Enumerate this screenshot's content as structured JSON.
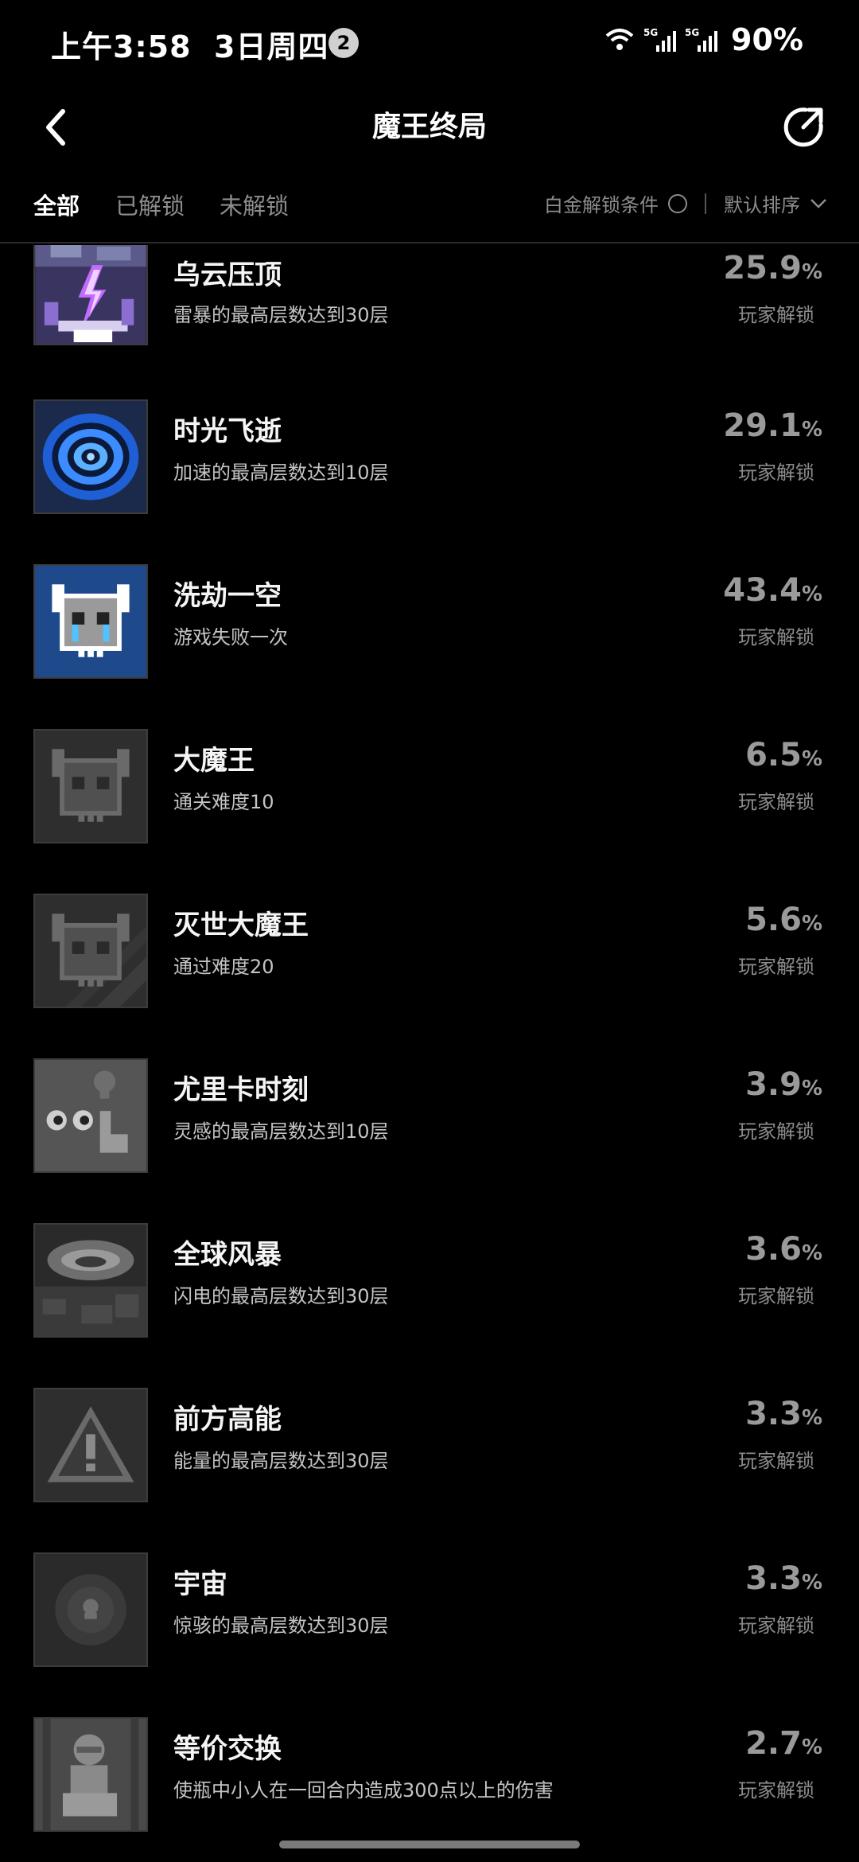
{
  "status": {
    "time": "上午3:58",
    "date": "3日周四",
    "notification_count": "2",
    "network": "5G",
    "battery": "90%",
    "icons": [
      "wifi-icon",
      "signal-5g-icon",
      "signal-5g-icon"
    ]
  },
  "header": {
    "title": "魔王终局",
    "back_icon": "chevron-left-icon",
    "share_icon": "share-icon"
  },
  "filter": {
    "tabs": [
      {
        "label": "全部",
        "active": true
      },
      {
        "label": "已解锁",
        "active": false
      },
      {
        "label": "未解锁",
        "active": false
      }
    ],
    "platinum_label": "白金解锁条件",
    "sort_label": "默认排序"
  },
  "achievements": [
    {
      "title": "乌云压顶",
      "desc": "雷暴的最高层数达到30层",
      "pct": "25.9",
      "unit": "%",
      "sub": "玩家解锁",
      "icon": "lightning-icon",
      "unlocked": true
    },
    {
      "title": "时光飞逝",
      "desc": "加速的最高层数达到10层",
      "pct": "29.1",
      "unit": "%",
      "sub": "玩家解锁",
      "icon": "vortex-icon",
      "unlocked": true
    },
    {
      "title": "洗劫一空",
      "desc": "游戏失败一次",
      "pct": "43.4",
      "unit": "%",
      "sub": "玩家解锁",
      "icon": "crying-demon-icon",
      "unlocked": true
    },
    {
      "title": "大魔王",
      "desc": "通关难度10",
      "pct": "6.5",
      "unit": "%",
      "sub": "玩家解锁",
      "icon": "demon-skull-icon",
      "unlocked": false
    },
    {
      "title": "灭世大魔王",
      "desc": "通过难度20",
      "pct": "5.6",
      "unit": "%",
      "sub": "玩家解锁",
      "icon": "demon-skull-icon",
      "unlocked": false
    },
    {
      "title": "尤里卡时刻",
      "desc": "灵感的最高层数达到10层",
      "pct": "3.9",
      "unit": "%",
      "sub": "玩家解锁",
      "icon": "eureka-icon",
      "unlocked": false
    },
    {
      "title": "全球风暴",
      "desc": "闪电的最高层数达到30层",
      "pct": "3.6",
      "unit": "%",
      "sub": "玩家解锁",
      "icon": "storm-icon",
      "unlocked": false
    },
    {
      "title": "前方高能",
      "desc": "能量的最高层数达到30层",
      "pct": "3.3",
      "unit": "%",
      "sub": "玩家解锁",
      "icon": "warning-icon",
      "unlocked": false
    },
    {
      "title": "宇宙",
      "desc": "惊骇的最高层数达到30层",
      "pct": "3.3",
      "unit": "%",
      "sub": "玩家解锁",
      "icon": "cosmos-icon",
      "unlocked": false
    },
    {
      "title": "等价交换",
      "desc": "使瓶中小人在一回合内造成300点以上的伤害",
      "pct": "2.7",
      "unit": "%",
      "sub": "玩家解锁",
      "icon": "bottle-figure-icon",
      "unlocked": false
    }
  ],
  "colors": {
    "background": "#000000",
    "text_primary": "#ffffff",
    "text_secondary": "#8c8c8c",
    "locked_icon": "#4a4a4a",
    "crying_demon_bg": "#1e4a8c",
    "vortex_blue": "#2f7cff"
  }
}
